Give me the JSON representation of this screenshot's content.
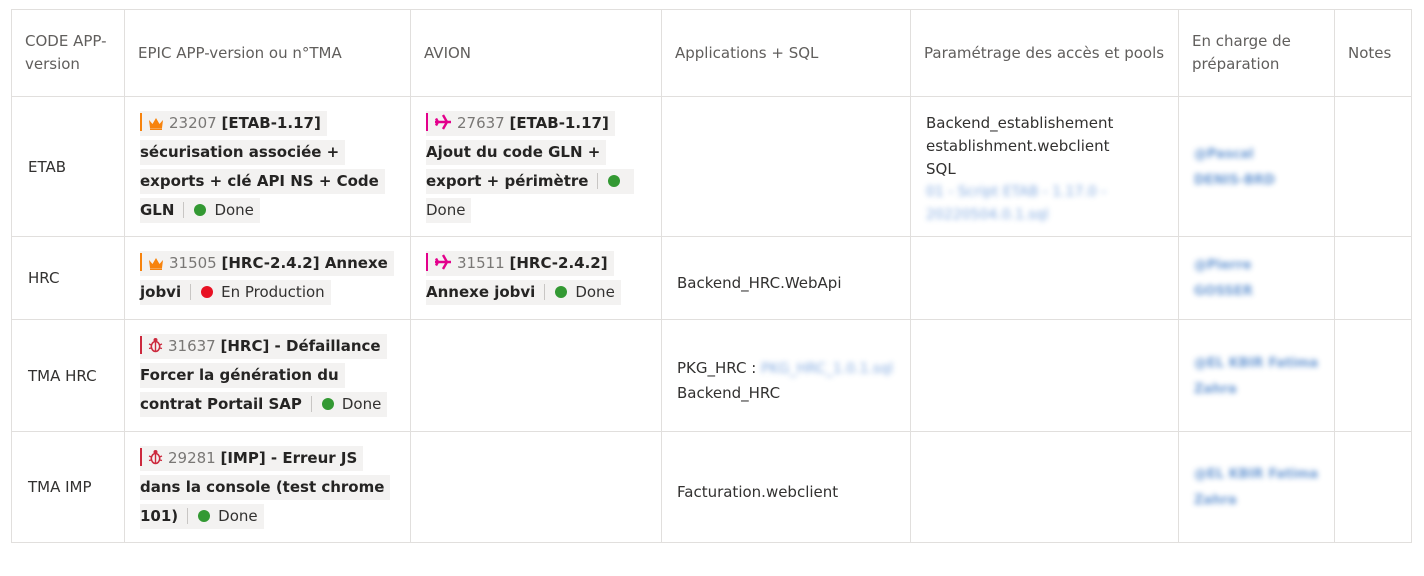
{
  "headers": {
    "code": "CODE APP-version",
    "epic": "EPIC APP-version ou n°TMA",
    "avion": "AVION",
    "apps": "Applications + SQL",
    "params": "Paramétrage des accès et pools",
    "owner": "En charge de préparation",
    "notes": "Notes"
  },
  "colors": {
    "crown": "#f7830d",
    "plane": "#e3008c",
    "bug": "#cc293d",
    "done": "#339933",
    "production": "#e81123"
  },
  "rows": [
    {
      "code": "ETAB",
      "epic": {
        "icon": "crown-icon",
        "id": "23207",
        "title": "[ETAB-1.17] sécurisation associée + exports + clé API NS + Code GLN",
        "status": "Done"
      },
      "avion": {
        "icon": "plane-icon",
        "id": "27637",
        "title": "[ETAB-1.17] Ajout du code GLN + export + périmètre",
        "status": "Done"
      },
      "apps": [],
      "params": [
        "Backend_establishement",
        "establishment.webclient"
      ],
      "params_sql_label": "SQL",
      "params_sql_link": "01 - Script ETAB - 1.17.0 - 20220504.0.1.sql",
      "owner": [
        "@Pascal",
        "DENIS-BRD"
      ]
    },
    {
      "code": "HRC",
      "epic": {
        "icon": "crown-icon",
        "id": "31505",
        "title": "[HRC-2.4.2] Annexe jobvi",
        "status": "En Production"
      },
      "avion": {
        "icon": "plane-icon",
        "id": "31511",
        "title": "[HRC-2.4.2] Annexe jobvi",
        "status": "Done"
      },
      "apps": [
        "Backend_HRC.WebApi"
      ],
      "owner": [
        "@Pierre",
        "GOSSER"
      ]
    },
    {
      "code": "TMA HRC",
      "epic": {
        "icon": "bug-icon",
        "id": "31637",
        "title": "[HRC] - Défaillance Forcer la génération du contrat Portail SAP",
        "status": "Done"
      },
      "apps": [
        "PKG_HRC :",
        "Backend_HRC"
      ],
      "apps_link": "PKG_HRC_1.0.1.sql",
      "owner": [
        "@EL KBIR",
        "Fatima",
        "Zahra"
      ]
    },
    {
      "code": "TMA IMP",
      "epic": {
        "icon": "bug-icon",
        "id": "29281",
        "title": "[IMP] - Erreur JS dans la console (test chrome 101)",
        "status": "Done"
      },
      "apps": [
        "Facturation.webclient"
      ],
      "owner": [
        "@EL KBIR",
        "Fatima",
        "Zahra"
      ]
    }
  ]
}
